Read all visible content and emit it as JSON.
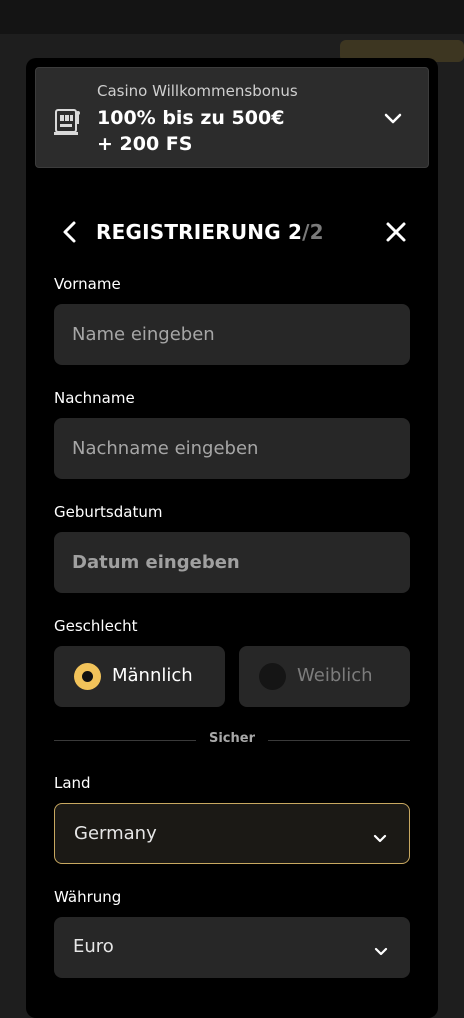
{
  "bonus": {
    "label": "Casino Willkommensbonus",
    "title_line1": "100% bis zu 500€",
    "title_line2": "+ 200 FS",
    "icon": "slot-machine-icon"
  },
  "header": {
    "title": "REGISTRIERUNG 2",
    "step_total": "/2",
    "back_icon": "chevron-left-icon",
    "close_icon": "close-icon"
  },
  "form": {
    "first_name": {
      "label": "Vorname",
      "placeholder": "Name eingeben",
      "value": ""
    },
    "last_name": {
      "label": "Nachname",
      "placeholder": "Nachname eingeben",
      "value": ""
    },
    "birthdate": {
      "label": "Geburtsdatum",
      "placeholder": "Datum eingeben",
      "value": ""
    },
    "gender": {
      "label": "Geschlecht",
      "options": [
        {
          "label": "Männlich",
          "selected": true
        },
        {
          "label": "Weiblich",
          "selected": false
        }
      ]
    },
    "divider": "Sicher",
    "country": {
      "label": "Land",
      "value": "Germany"
    },
    "currency": {
      "label": "Währung",
      "value": "Euro"
    }
  },
  "colors": {
    "accent": "#f2c35a",
    "background": "#000000",
    "field": "#272727"
  }
}
